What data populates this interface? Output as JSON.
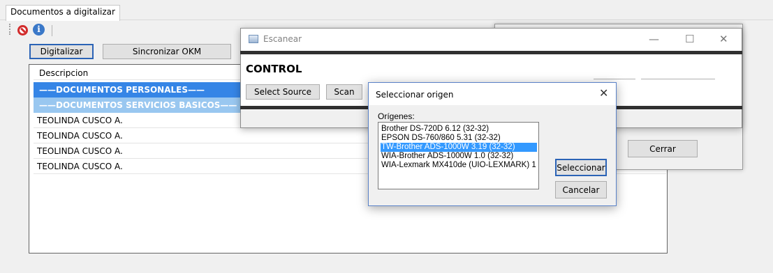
{
  "main": {
    "tab_label": "Documentos a digitalizar",
    "buttons": {
      "digitalizar": "Digitalizar",
      "sincronizar": "Sincronizar OKM"
    },
    "toolbar_icons": [
      "block-icon",
      "info-icon"
    ],
    "list": {
      "header": "Descripcion",
      "rows": [
        "——DOCUMENTOS PERSONALES——",
        "——DOCUMENTOS SERVICIOS BASICOS——",
        "TEOLINDA CUSCO A.",
        "TEOLINDA CUSCO A.",
        "TEOLINDA CUSCO A.",
        "TEOLINDA CUSCO A."
      ]
    }
  },
  "back_dialog": {
    "cerrar": "Cerrar",
    "window_controls": [
      "—",
      "☐",
      "✕"
    ]
  },
  "escanear": {
    "title": "Escanear",
    "control_label": "CONTROL",
    "select_source": "Select Source",
    "scan": "Scan"
  },
  "seleccionar_origen": {
    "title": "Seleccionar origen",
    "close": "✕",
    "origenes_label": "Orígenes:",
    "sources": [
      "Brother DS-720D 6.12 (32-32)",
      "EPSON DS-760/860 5.31 (32-32)",
      "TW-Brother ADS-1000W 3.19 (32-32)",
      "WIA-Brother ADS-1000W 1.0 (32-32)",
      "WIA-Lexmark MX410de (UIO-LEXMARK) 1"
    ],
    "selected_source": "TW-Brother ADS-1000W 3.19 (32-32)",
    "seleccionar": "Seleccionar",
    "cancelar": "Cancelar"
  },
  "colors": {
    "selection_blue": "#3585e6",
    "selection_light_blue": "#99c7f0",
    "list_highlight": "#3399ff"
  }
}
